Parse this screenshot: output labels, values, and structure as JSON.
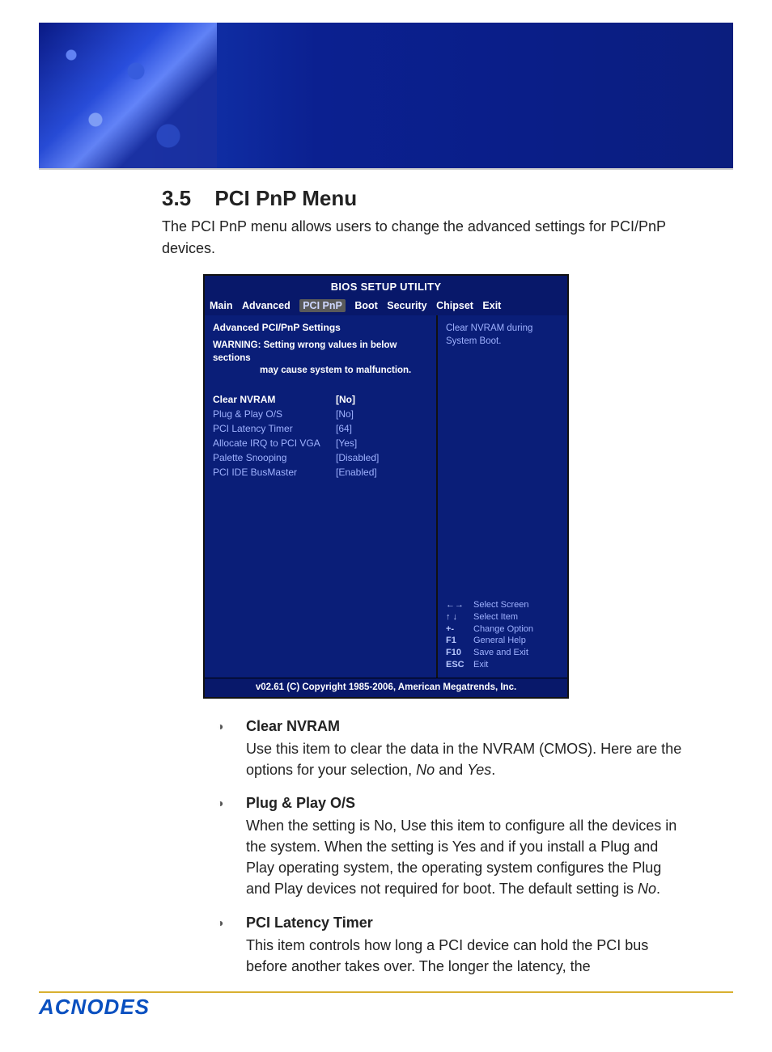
{
  "section": {
    "number": "3.5",
    "title": "PCI PnP Menu"
  },
  "intro": "The PCI PnP menu allows users to change the advanced settings for PCI/PnP devices.",
  "bios": {
    "title": "BIOS SETUP UTILITY",
    "tabs": [
      "Main",
      "Advanced",
      "PCI PnP",
      "Boot",
      "Security",
      "Chipset",
      "Exit"
    ],
    "active_tab_index": 2,
    "subheading": "Advanced PCI/PnP Settings",
    "warning_line1": "WARNING: Setting wrong values in below sections",
    "warning_line2": "may cause system to malfunction.",
    "settings": [
      {
        "label": "Clear NVRAM",
        "value": "[No]",
        "selected": true
      },
      {
        "label": "Plug & Play O/S",
        "value": "[No]",
        "selected": false
      },
      {
        "label": "PCI Latency Timer",
        "value": "[64]",
        "selected": false
      },
      {
        "label": "Allocate IRQ to PCI VGA",
        "value": "[Yes]",
        "selected": false
      },
      {
        "label": "Palette Snooping",
        "value": "[Disabled]",
        "selected": false
      },
      {
        "label": "PCI IDE BusMaster",
        "value": "[Enabled]",
        "selected": false
      }
    ],
    "help_text": "Clear NVRAM during System Boot.",
    "keyhelp": [
      {
        "key": "←→",
        "text": "Select Screen"
      },
      {
        "key": "↑ ↓",
        "text": "Select Item"
      },
      {
        "key": "+-",
        "text": "Change Option"
      },
      {
        "key": "F1",
        "text": "General Help"
      },
      {
        "key": "F10",
        "text": "Save and Exit"
      },
      {
        "key": "ESC",
        "text": "Exit"
      }
    ],
    "footer": "v02.61 (C) Copyright 1985-2006, American Megatrends, Inc."
  },
  "options": [
    {
      "title": "Clear NVRAM",
      "desc_pre": "Use this item to clear the data in the NVRAM (CMOS). Here are the options for your selection, ",
      "ital1": "No",
      "mid": " and ",
      "ital2": "Yes",
      "post": "."
    },
    {
      "title": "Plug & Play O/S",
      "desc_pre": "When the setting is No, Use this item to configure all the devices in the system. When the setting is Yes and if you install a Plug and Play operating system, the operating system configures the Plug and Play devices not required for boot. The default setting is ",
      "ital1": "No",
      "mid": "",
      "ital2": "",
      "post": "."
    },
    {
      "title": "PCI Latency Timer",
      "desc_pre": "This item controls how long a PCI device can hold the PCI bus before another takes over. The longer the latency, the",
      "ital1": "",
      "mid": "",
      "ital2": "",
      "post": ""
    }
  ],
  "brand": "ACNODES"
}
